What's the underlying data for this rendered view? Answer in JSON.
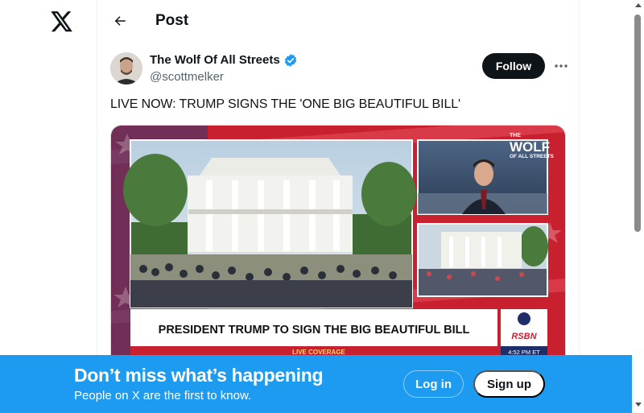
{
  "nav": {
    "logo_icon": "x-logo-icon"
  },
  "header": {
    "title": "Post",
    "back_icon": "arrow-left-icon"
  },
  "post": {
    "author": {
      "display_name": "The Wolf Of All Streets",
      "handle": "@scottmelker",
      "verified": true
    },
    "follow_label": "Follow",
    "more_icon": "more-horizontal-icon",
    "text": "LIVE NOW: TRUMP SIGNS THE 'ONE BIG BEAUTIFUL BILL'",
    "media": {
      "brand_top": "THE",
      "brand_main": "WOLF",
      "brand_sub": "OF ALL STREETS",
      "lower_third_headline": "PRESIDENT TRUMP TO SIGN THE BIG BEAUTIFUL BILL",
      "lower_third_tag": "LIVE COVERAGE",
      "network_logo": "RSBN",
      "clock": "4:52 PM ET"
    }
  },
  "banner": {
    "title": "Don’t miss what’s happening",
    "subtitle": "People on X are the first to know.",
    "login_label": "Log in",
    "signup_label": "Sign up"
  },
  "colors": {
    "accent": "#1d9bf0",
    "text": "#0f1419",
    "muted": "#536471",
    "broadcast_red": "#c8202e",
    "broadcast_navy": "#1d2e6b"
  }
}
